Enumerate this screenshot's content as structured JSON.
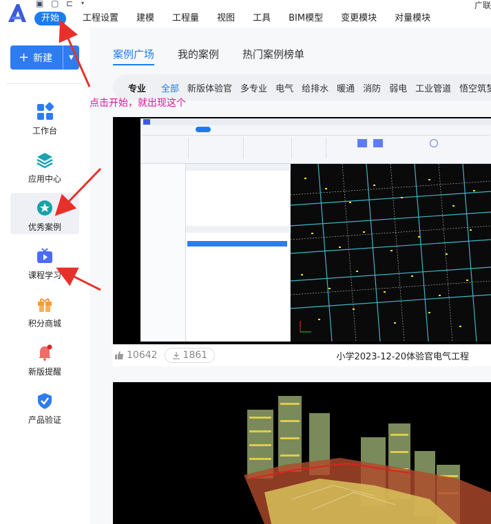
{
  "topbar": {
    "menu": [
      {
        "label": "开始",
        "active": true
      },
      {
        "label": "工程设置"
      },
      {
        "label": "建模"
      },
      {
        "label": "工程量"
      },
      {
        "label": "视图"
      },
      {
        "label": "工具"
      },
      {
        "label": "BIM模型"
      },
      {
        "label": "变更模块"
      },
      {
        "label": "对量模块"
      }
    ],
    "user_name": "广联"
  },
  "sidebar": {
    "new_button": "新建",
    "items": [
      {
        "label": "工作台",
        "icon": "grid-icon"
      },
      {
        "label": "应用中心",
        "icon": "layers-icon"
      },
      {
        "label": "优秀案例",
        "icon": "star-badge-icon",
        "active": true
      },
      {
        "label": "课程学习",
        "icon": "tv-play-icon"
      },
      {
        "label": "积分商城",
        "icon": "gift-icon"
      },
      {
        "label": "新版提醒",
        "icon": "bell-icon"
      },
      {
        "label": "产品验证",
        "icon": "shield-check-icon"
      }
    ]
  },
  "main": {
    "tabs": [
      {
        "label": "案例广场",
        "active": true
      },
      {
        "label": "我的案例"
      },
      {
        "label": "热门案例榜单"
      }
    ],
    "filter": {
      "heading": "专业",
      "items": [
        "全部",
        "新版体验官",
        "多专业",
        "电气",
        "给排水",
        "暖通",
        "消防",
        "弱电",
        "工业管道",
        "悟空筑梦"
      ],
      "active": "全部"
    },
    "cards": [
      {
        "likes": "10642",
        "downloads": "1861",
        "title": "小学2023-12-20体验官电气工程"
      }
    ]
  },
  "annotation": {
    "text": "点击开始，就出现这个"
  },
  "colors": {
    "accent": "#1b7cf0",
    "annotation": "#e0109a",
    "arrow": "#e8302a"
  }
}
